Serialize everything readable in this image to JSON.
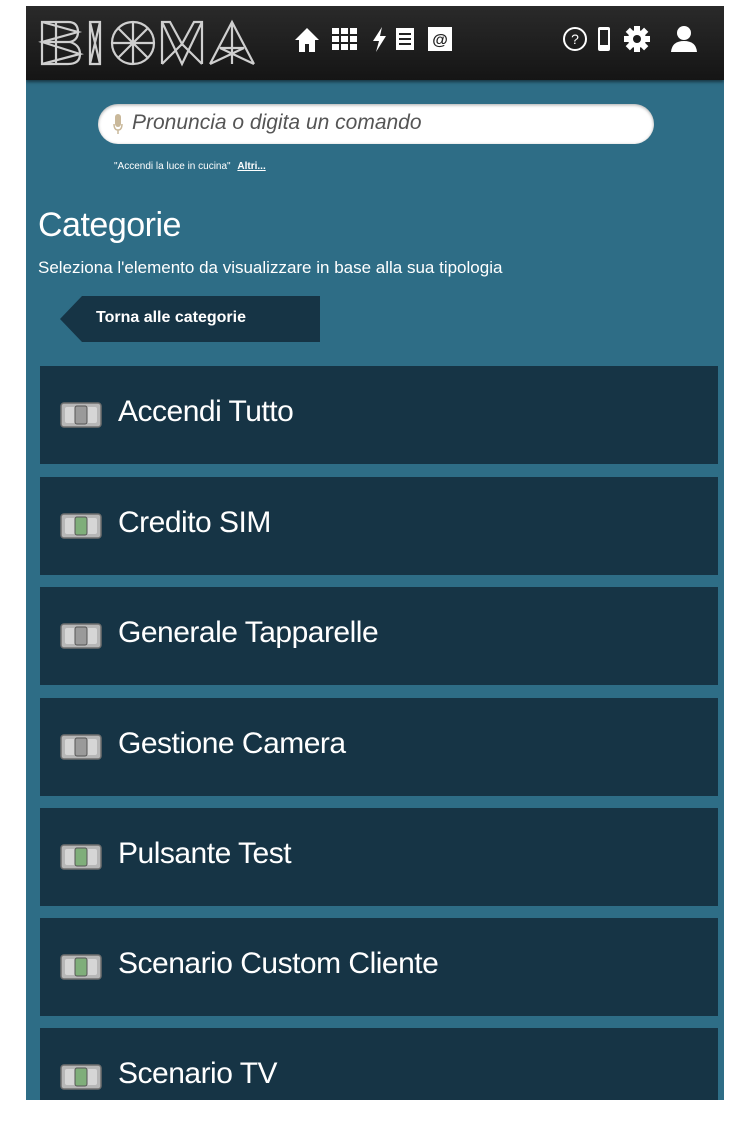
{
  "header": {
    "logo_text": "BIOMA",
    "nav_icons_left": [
      "home-icon",
      "grid-icon",
      "lightning-icon",
      "document-icon",
      "at-icon"
    ],
    "nav_icons_right": [
      "help-icon",
      "phone-icon",
      "gear-icon",
      "user-icon"
    ]
  },
  "command": {
    "placeholder": "Pronuncia o digita un comando",
    "hint": "\"Accendi la luce in cucina\"",
    "more_link": "Altri..."
  },
  "page": {
    "title": "Categorie",
    "subtitle": "Seleziona l'elemento da visualizzare in base alla sua tipologia",
    "back_label": "Torna alle categorie"
  },
  "items": [
    {
      "label": "Accendi Tutto",
      "icon": "switch-icon",
      "tint": "#9a9a9a"
    },
    {
      "label": "Credito SIM",
      "icon": "switch-icon",
      "tint": "#7fae7a"
    },
    {
      "label": "Generale Tapparelle",
      "icon": "switch-icon",
      "tint": "#9a9a9a"
    },
    {
      "label": "Gestione Camera",
      "icon": "switch-icon",
      "tint": "#9a9a9a"
    },
    {
      "label": "Pulsante Test",
      "icon": "switch-icon",
      "tint": "#7fae7a"
    },
    {
      "label": "Scenario Custom Cliente",
      "icon": "switch-icon",
      "tint": "#7fae7a"
    },
    {
      "label": "Scenario TV",
      "icon": "switch-icon",
      "tint": "#7fae7a"
    }
  ],
  "colors": {
    "background": "#2e6d86",
    "item_background": "#163445",
    "topbar": "#1c1c1c"
  }
}
